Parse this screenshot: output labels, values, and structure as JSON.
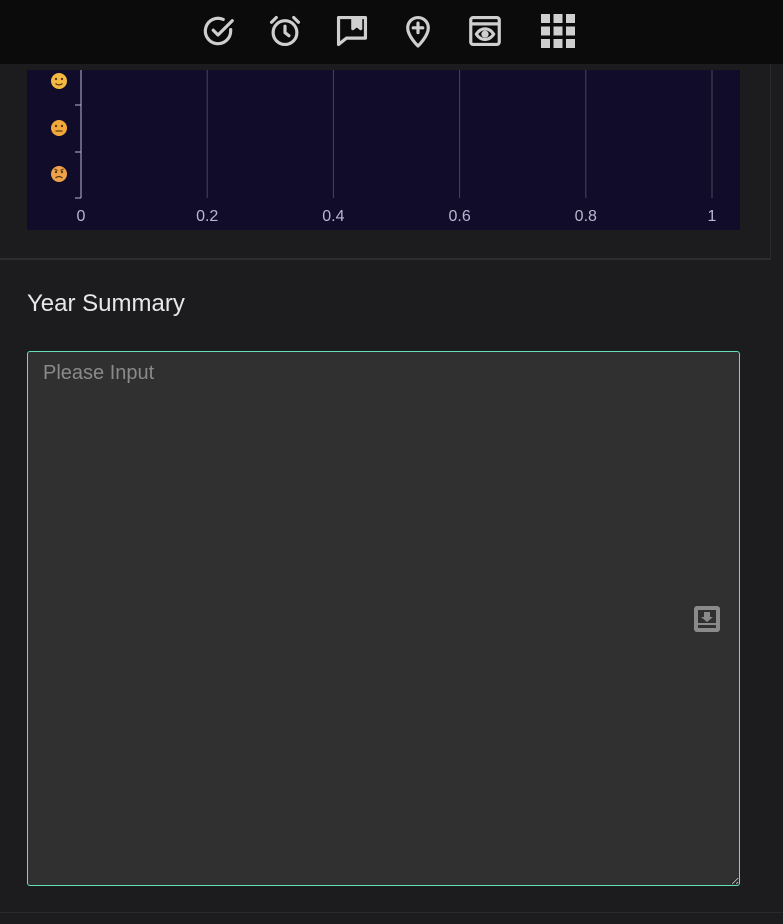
{
  "toolbar": {
    "icons": [
      "check-circle-icon",
      "alarm-clock-icon",
      "bookmark-comment-icon",
      "location-add-icon",
      "preview-eye-icon",
      "apps-grid-icon"
    ],
    "icon_color": "#cfcfcf"
  },
  "chart_data": {
    "type": "bar",
    "orientation": "horizontal",
    "categories": [
      "🙂",
      "😑",
      "😠"
    ],
    "values": [
      0,
      0,
      0
    ],
    "xlim": [
      0,
      1
    ],
    "xticks": [
      "0",
      "0.2",
      "0.4",
      "0.6",
      "0.8",
      "1"
    ],
    "grid": true,
    "background": "#100c2a"
  },
  "summary": {
    "title": "Year Summary",
    "placeholder": "Please Input",
    "value": "",
    "border_color": "#63e2b7"
  }
}
